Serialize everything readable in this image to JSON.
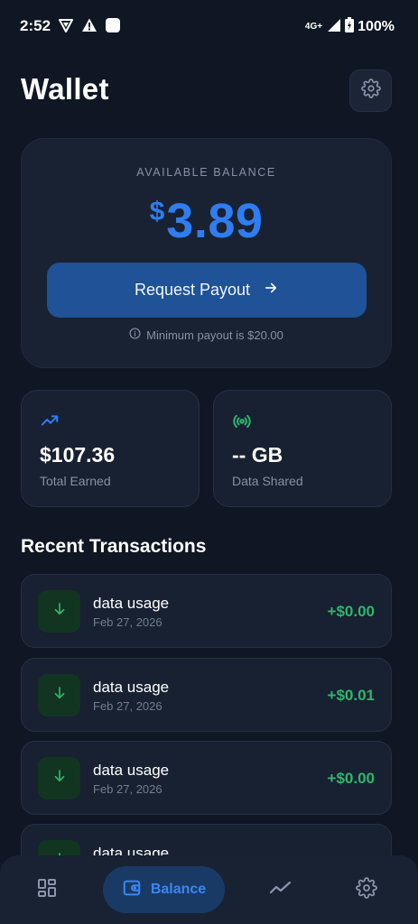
{
  "status_bar": {
    "time": "2:52",
    "network": "4G+",
    "battery": "100%"
  },
  "header": {
    "title": "Wallet"
  },
  "balance_card": {
    "label": "AVAILABLE BALANCE",
    "currency": "$",
    "amount": "3.89",
    "payout_button": "Request Payout",
    "min_payout_note": "Minimum payout is $20.00"
  },
  "stats": {
    "earned": {
      "value": "$107.36",
      "label": "Total Earned"
    },
    "data": {
      "value": "-- GB",
      "label": "Data Shared"
    }
  },
  "transactions": {
    "title": "Recent Transactions",
    "items": [
      {
        "title": "data usage",
        "date": "Feb 27, 2026",
        "amount": "+$0.00"
      },
      {
        "title": "data usage",
        "date": "Feb 27, 2026",
        "amount": "+$0.01"
      },
      {
        "title": "data usage",
        "date": "Feb 27, 2026",
        "amount": "+$0.00"
      },
      {
        "title": "data usage"
      }
    ]
  },
  "bottom_nav": {
    "balance_label": "Balance"
  },
  "colors": {
    "background": "#0f1724",
    "card": "#182233",
    "accent_blue": "#2f7df0",
    "payout_button": "#1f5296",
    "positive_green": "#2fb66c"
  }
}
